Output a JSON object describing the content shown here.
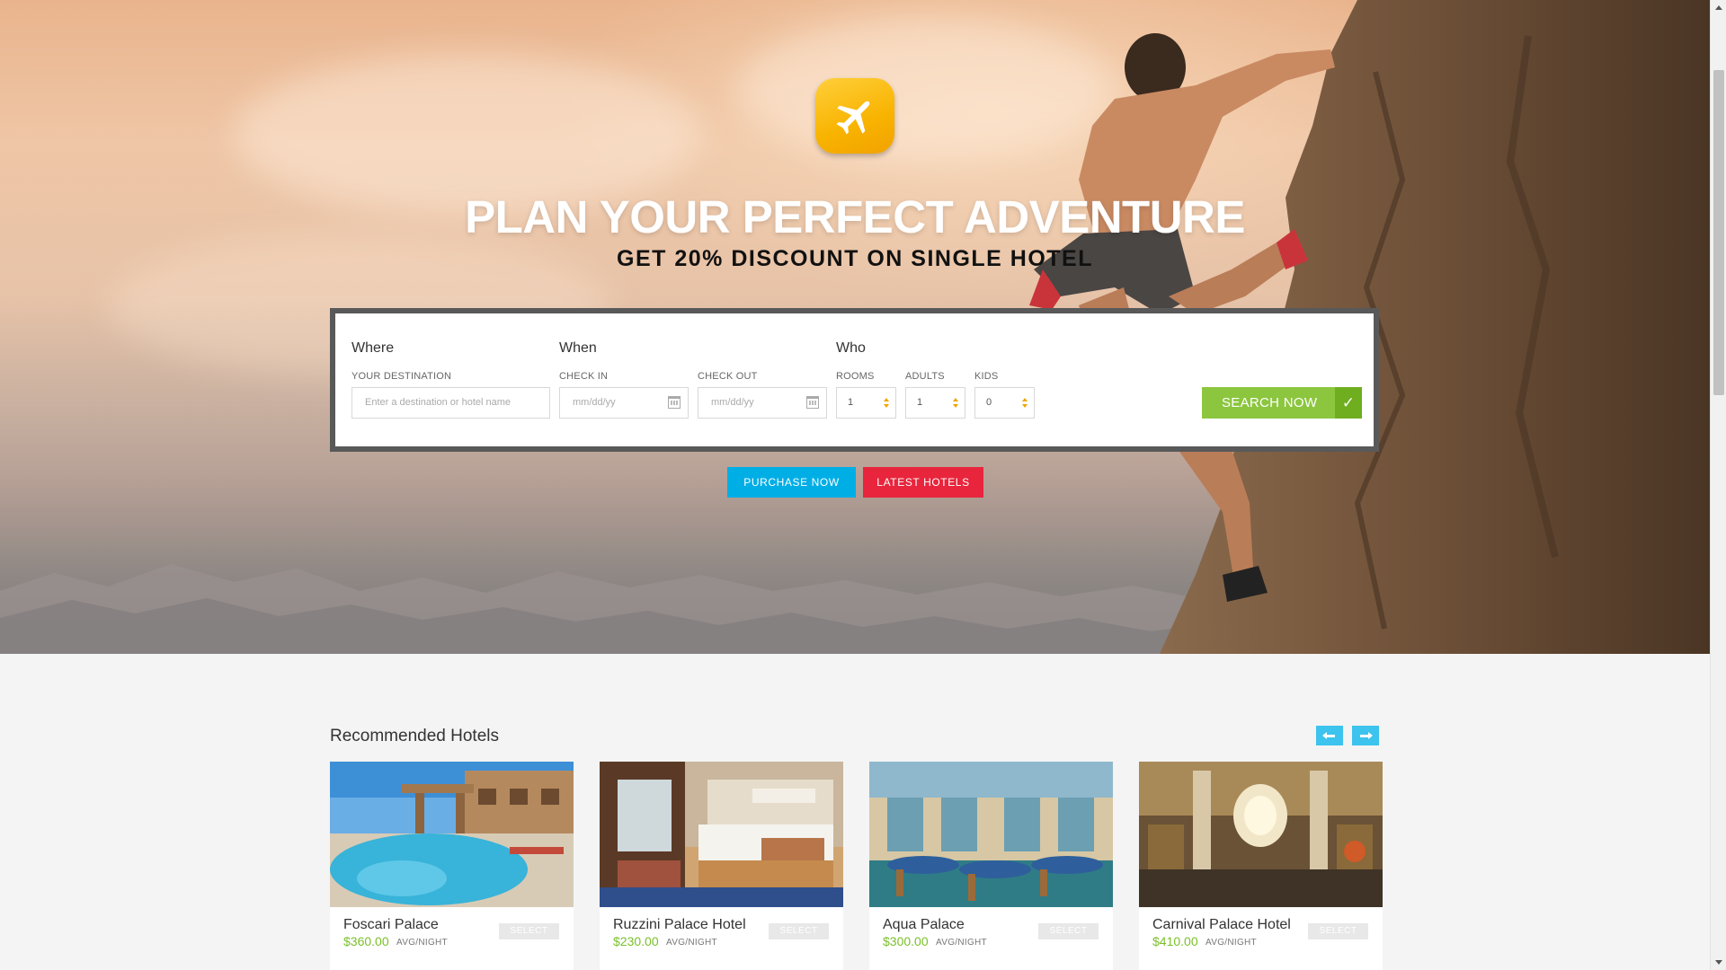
{
  "hero": {
    "title": "PLAN YOUR PERFECT ADVENTURE",
    "subtitle": "GET 20% DISCOUNT ON SINGLE HOTEL"
  },
  "search": {
    "where_heading": "Where",
    "when_heading": "When",
    "who_heading": "Who",
    "destination_label": "YOUR DESTINATION",
    "destination_placeholder": "Enter a destination or hotel name",
    "checkin_label": "CHECK IN",
    "checkin_placeholder": "mm/dd/yy",
    "checkout_label": "CHECK OUT",
    "checkout_placeholder": "mm/dd/yy",
    "rooms_label": "ROOMS",
    "rooms_value": "1",
    "adults_label": "ADULTS",
    "adults_value": "1",
    "kids_label": "KIDS",
    "kids_value": "0",
    "search_button": "SEARCH NOW",
    "search_check": "✓"
  },
  "actions": {
    "purchase": "PURCHASE NOW",
    "latest": "LATEST HOTELS"
  },
  "recommended": {
    "title": "Recommended Hotels",
    "hotels": [
      {
        "name": "Foscari Palace",
        "price": "$360.00",
        "unit": "AVG/NIGHT",
        "select": "SELECT"
      },
      {
        "name": "Ruzzini Palace Hotel",
        "price": "$230.00",
        "unit": "AVG/NIGHT",
        "select": "SELECT"
      },
      {
        "name": "Aqua Palace",
        "price": "$300.00",
        "unit": "AVG/NIGHT",
        "select": "SELECT"
      },
      {
        "name": "Carnival Palace Hotel",
        "price": "$410.00",
        "unit": "AVG/NIGHT",
        "select": "SELECT"
      }
    ]
  },
  "colors": {
    "accent_blue": "#00aee6",
    "accent_red": "#e8253c",
    "accent_green": "#8cc63f",
    "logo_yellow": "#f8b300"
  },
  "icons": {
    "logo": "airplane-icon",
    "calendar": "calendar-icon",
    "prev": "arrow-left-icon",
    "next": "arrow-right-icon",
    "check": "check-icon"
  }
}
